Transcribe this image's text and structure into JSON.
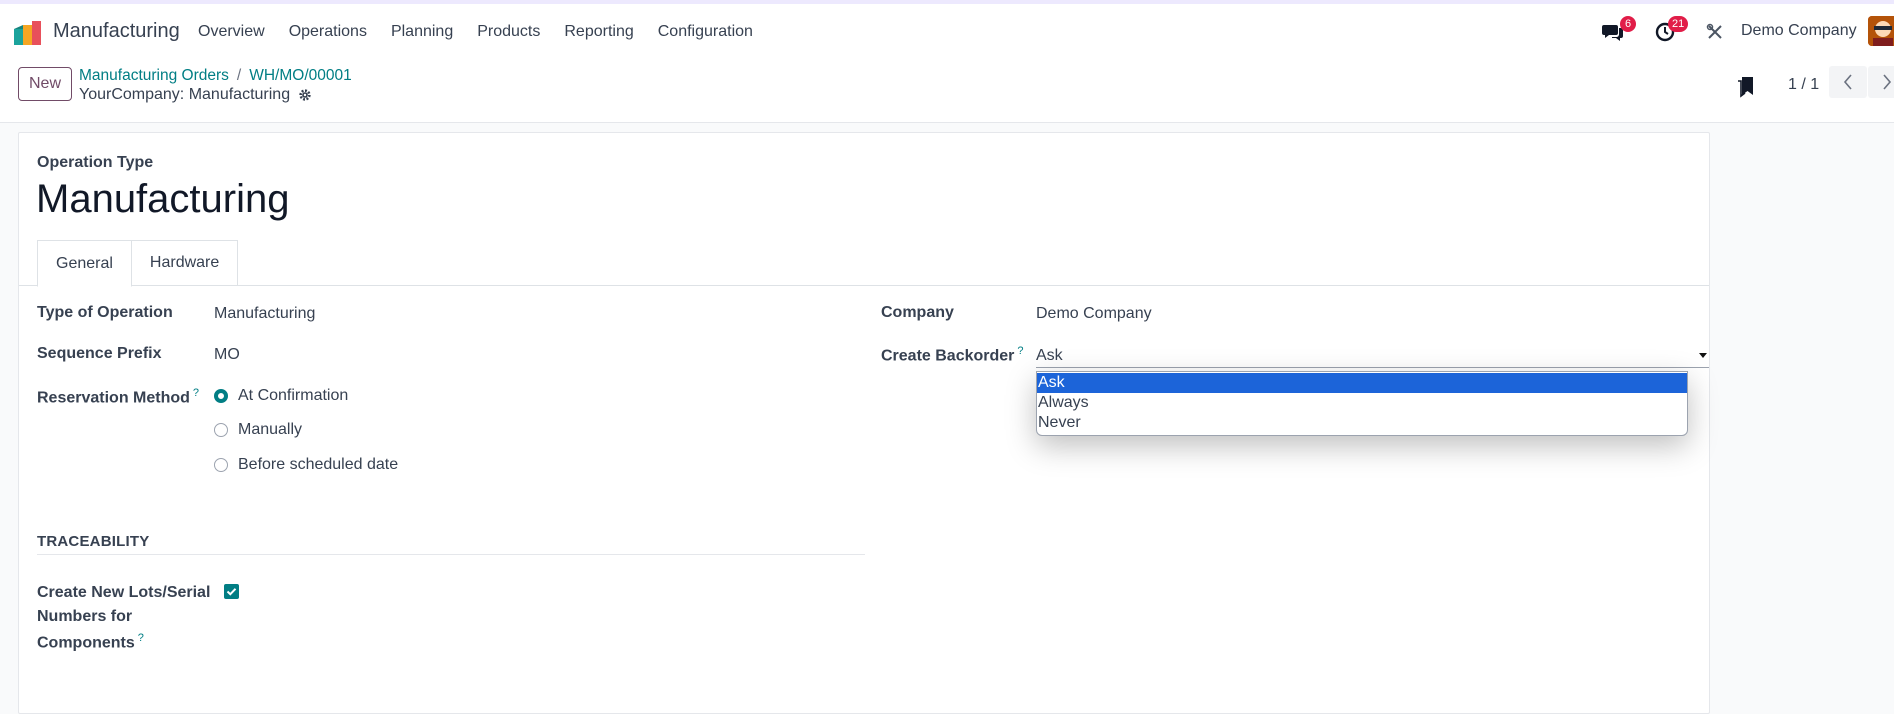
{
  "navbar": {
    "app_name": "Manufacturing",
    "menu": [
      "Overview",
      "Operations",
      "Planning",
      "Products",
      "Reporting",
      "Configuration"
    ],
    "messages_count": "6",
    "activities_count": "21",
    "company": "Demo Company"
  },
  "control": {
    "new_label": "New",
    "breadcrumb_parent": "Manufacturing Orders",
    "breadcrumb_separator": "/",
    "breadcrumb_current": "WH/MO/00001",
    "subtitle": "YourCompany: Manufacturing",
    "pager": "1 / 1"
  },
  "form": {
    "type_label": "Operation Type",
    "title": "Manufacturing",
    "tabs": [
      "General",
      "Hardware"
    ],
    "fields": {
      "type_of_operation_label": "Type of Operation",
      "type_of_operation_value": "Manufacturing",
      "sequence_prefix_label": "Sequence Prefix",
      "sequence_prefix_value": "MO",
      "reservation_method_label": "Reservation Method",
      "reservation_options": [
        "At Confirmation",
        "Manually",
        "Before scheduled date"
      ],
      "reservation_selected": "At Confirmation",
      "company_label": "Company",
      "company_value": "Demo Company",
      "create_backorder_label": "Create Backorder",
      "create_backorder_value": "Ask",
      "backorder_options": [
        "Ask",
        "Always",
        "Never"
      ]
    },
    "traceability": {
      "heading": "TRACEABILITY",
      "lots_label_line1": "Create New Lots/Serial",
      "lots_label_line2": "Numbers for",
      "lots_label_line3": "Components",
      "lots_checked": true
    },
    "help_mark": "?"
  },
  "colors": {
    "accent": "#017e84",
    "brand": "#714b67",
    "badge": "#e11d48",
    "selected_option": "#1c64d9"
  }
}
